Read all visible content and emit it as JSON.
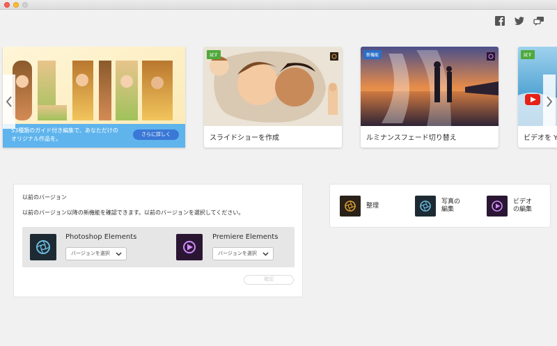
{
  "colors": {
    "background": "#f1f1f1",
    "banner_blue": "#53aff0",
    "more_button": "#3a78d6",
    "badge_green": "#4fa93c",
    "badge_blue": "#2b6ec7",
    "elements_dark": "#1d2a33",
    "elements_accent": "#6ab9dd",
    "premiere_dark": "#2a1633",
    "premiere_accent": "#d28bff",
    "organizer_accent": "#e0a233"
  },
  "social": {
    "icons": [
      "facebook-icon",
      "twitter-icon",
      "feedback-icon"
    ]
  },
  "carousel": {
    "hero": {
      "title_image_text": "OLIVIA",
      "banner_text": "53種類のガイド付き編集で、あなただけのオリジナル作品を。",
      "more_button": "さらに詳しく"
    },
    "cards": [
      {
        "badge": "試す",
        "caption": "スライドショーを作成"
      },
      {
        "badge": "新機能",
        "caption": "ルミナンスフェード切り替え"
      },
      {
        "badge": "試す",
        "caption": "ビデオを Yo"
      }
    ]
  },
  "previous": {
    "title": "以前のバージョン",
    "description": "以前のバージョン以降の新機能を確認できます。以前のバージョンを選択してください。",
    "apps": [
      {
        "name": "Photoshop Elements",
        "select_placeholder": "バージョンを選択"
      },
      {
        "name": "Premiere Elements",
        "select_placeholder": "バージョンを選択"
      }
    ],
    "confirm": "確認"
  },
  "launch": {
    "items": [
      {
        "label": "整理"
      },
      {
        "label": "写真の\n編集"
      },
      {
        "label": "ビデオ\nの編集"
      }
    ]
  }
}
